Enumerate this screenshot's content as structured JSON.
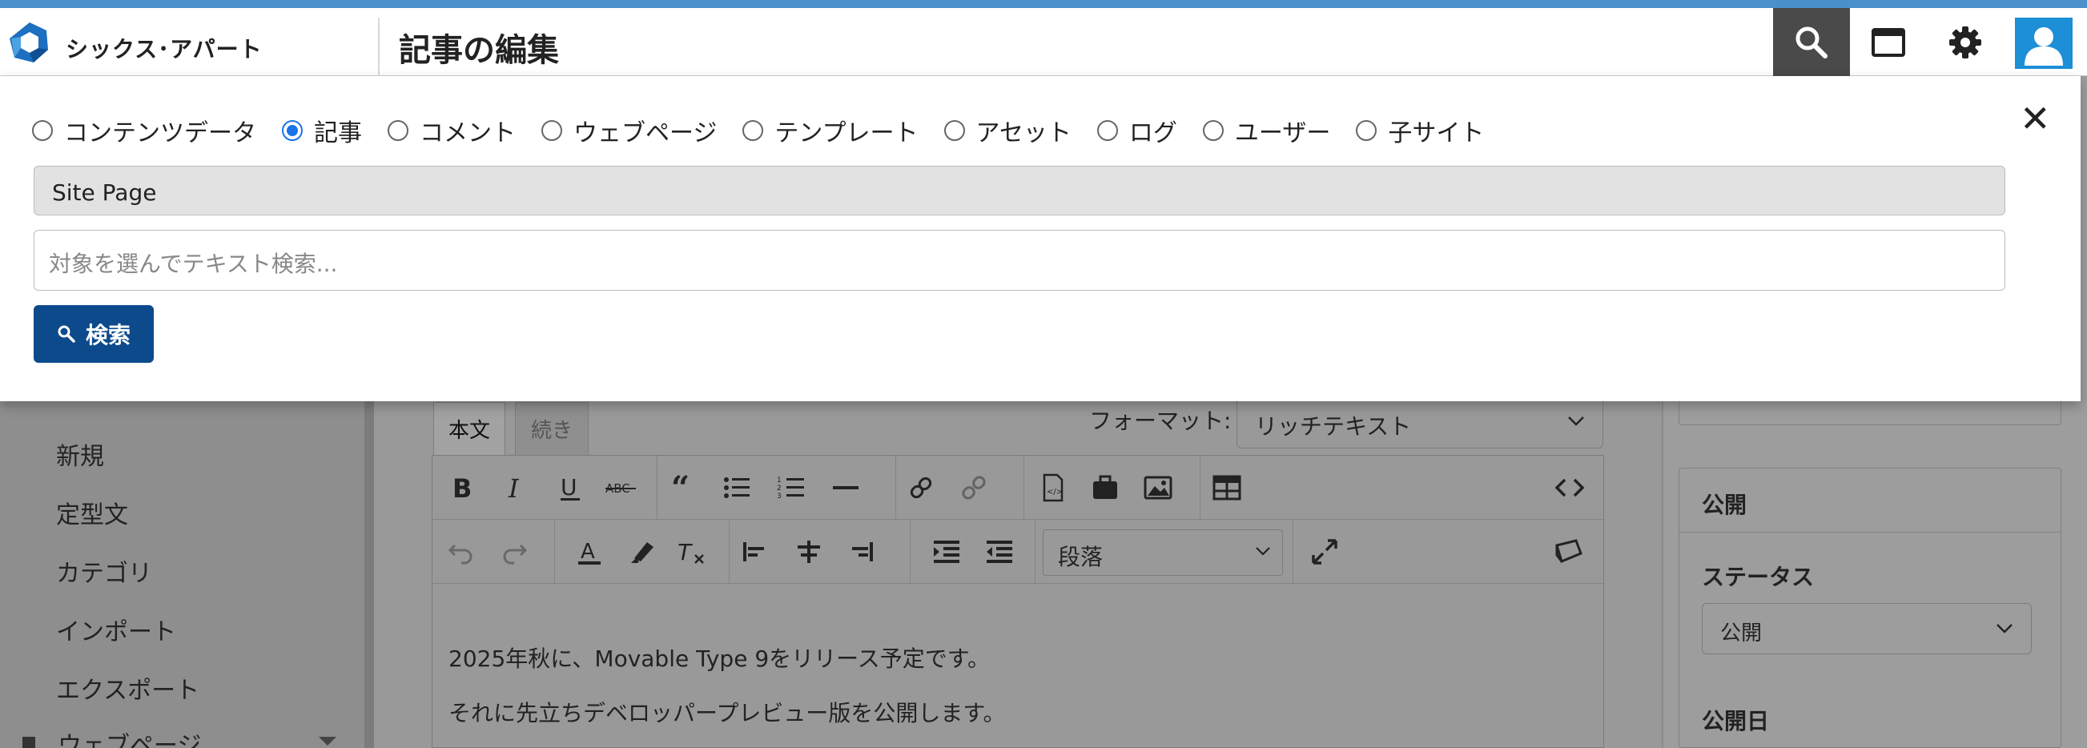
{
  "header": {
    "brand": "シックス･アパート",
    "page_title": "記事の編集",
    "buttons": [
      "search-icon",
      "window-icon",
      "gear-icon",
      "user-avatar-icon"
    ]
  },
  "search_panel": {
    "targets": [
      {
        "label": "コンテンツデータ",
        "checked": false
      },
      {
        "label": "記事",
        "checked": true
      },
      {
        "label": "コメント",
        "checked": false
      },
      {
        "label": "ウェブページ",
        "checked": false
      },
      {
        "label": "テンプレート",
        "checked": false
      },
      {
        "label": "アセット",
        "checked": false
      },
      {
        "label": "ログ",
        "checked": false
      },
      {
        "label": "ユーザー",
        "checked": false
      },
      {
        "label": "子サイト",
        "checked": false
      }
    ],
    "scope_value": "Site Page",
    "query_placeholder": "対象を選んでテキスト検索...",
    "search_button": "検索",
    "close_symbol": "✕"
  },
  "sidebar": {
    "items": [
      "新規",
      "定型文",
      "カテゴリ",
      "インポート",
      "エクスポート"
    ],
    "group": "ウェブページ"
  },
  "editor": {
    "tabs": [
      "本文",
      "続き"
    ],
    "format_label": "フォーマット:",
    "format_value": "リッチテキスト",
    "paragraph_value": "段落",
    "content": [
      "2025年秋に、Movable Type 9をリリース予定です。",
      "それに先立ちデベロッパープレビュー版を公開します。"
    ]
  },
  "publish": {
    "title": "公開",
    "status_label": "ステータス",
    "status_value": "公開",
    "date_label": "公開日"
  },
  "colors": {
    "accent": "#1a73e8",
    "button_primary": "#0c4a8c",
    "topline": "#4a90c9",
    "avatar": "#1c8fd6"
  }
}
